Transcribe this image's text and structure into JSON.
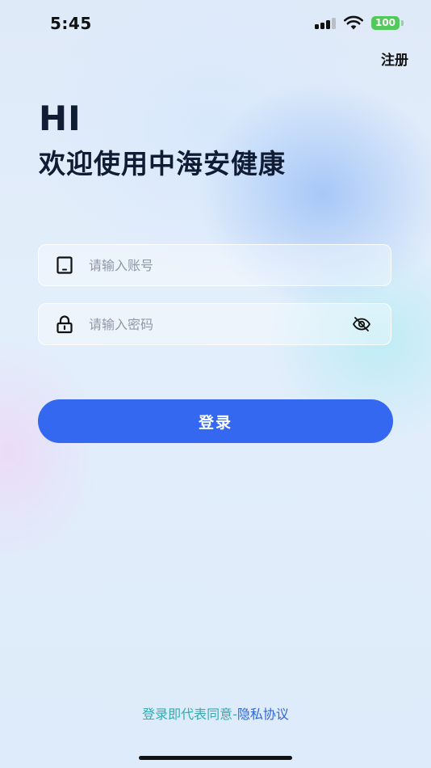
{
  "status_bar": {
    "time": "5:45",
    "battery": "100",
    "battery_color": "#53c85b"
  },
  "header": {
    "register_label": "注册"
  },
  "hero": {
    "greeting": "HI",
    "welcome": "欢迎使用中海安健康"
  },
  "form": {
    "account_placeholder": "请输入账号",
    "account_value": "",
    "password_placeholder": "请输入密码",
    "password_value": "",
    "account_icon": "phone-icon",
    "password_icon": "lock-icon",
    "visibility_icon": "eye-off-icon"
  },
  "login_button": {
    "label": "登录",
    "color": "#3568f0"
  },
  "agreement": {
    "prefix": "登录即代表同意-",
    "link": "隐私协议"
  }
}
